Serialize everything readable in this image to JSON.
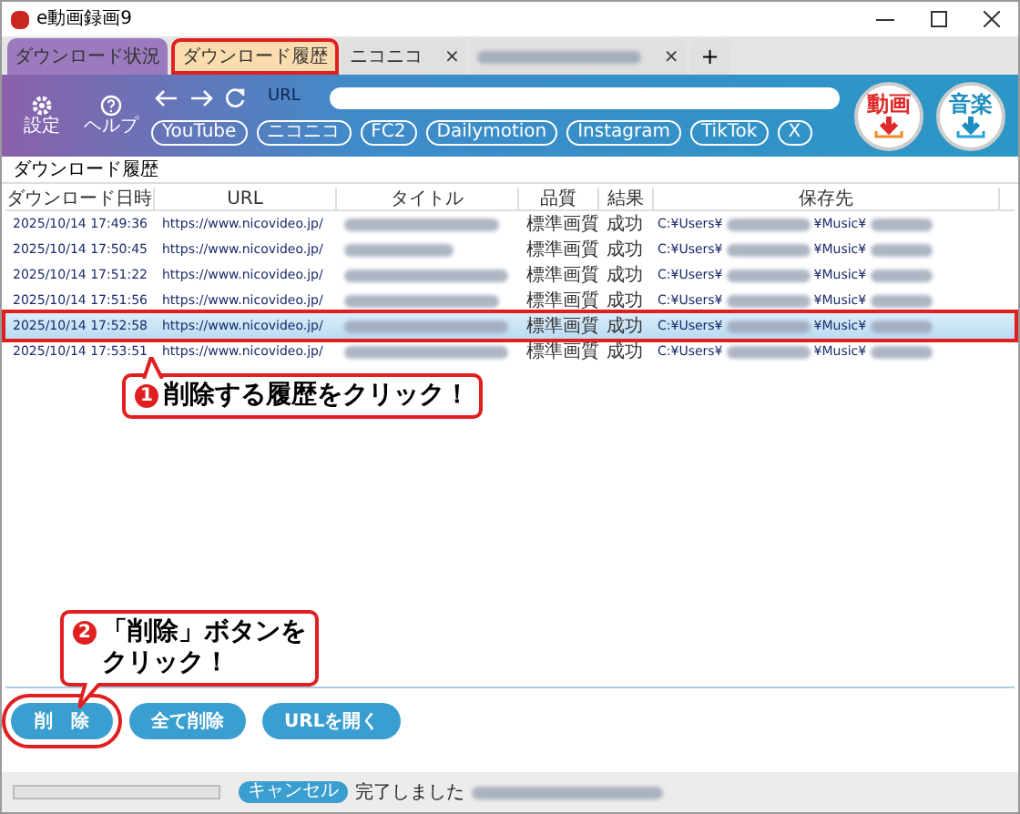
{
  "window": {
    "title": "e動画録画9"
  },
  "tabs": [
    {
      "label": "ダウンロード状況",
      "selected": false,
      "color": "#9b7bbd"
    },
    {
      "label": "ダウンロード履歴",
      "selected": true,
      "color": "#fbdcae"
    },
    {
      "label": "ニコニコ",
      "selected": false,
      "close": "×",
      "color": "#e0e0e0"
    },
    {
      "kind": "blurred",
      "selected": false,
      "close": "×",
      "color": "#e0e0e0"
    }
  ],
  "new_tab": "+",
  "toolbar": {
    "settings": "設定",
    "help": "ヘルプ",
    "url_label": "URL",
    "sites": [
      "YouTube",
      "ニコニコ",
      "FC2",
      "Dailymotion",
      "Instagram",
      "TikTok",
      "X"
    ],
    "video_button": "動画",
    "music_button": "音楽"
  },
  "section_title": "ダウンロード履歴",
  "table": {
    "columns": [
      "ダウンロード日時",
      "URL",
      "タイトル",
      "品質",
      "結果",
      "保存先"
    ],
    "rows": [
      {
        "date": "2025/10/14 17:49:36",
        "url": "https://www.nicovideo.jp/",
        "quality": "標準画質",
        "result": "成功",
        "path_start": "C:¥Users¥",
        "path_mid": "¥Music¥",
        "selected": false
      },
      {
        "date": "2025/10/14 17:50:45",
        "url": "https://www.nicovideo.jp/",
        "quality": "標準画質",
        "result": "成功",
        "path_start": "C:¥Users¥",
        "path_mid": "¥Music¥",
        "selected": false
      },
      {
        "date": "2025/10/14 17:51:22",
        "url": "https://www.nicovideo.jp/",
        "quality": "標準画質",
        "result": "成功",
        "path_start": "C:¥Users¥",
        "path_mid": "¥Music¥",
        "selected": false
      },
      {
        "date": "2025/10/14 17:51:56",
        "url": "https://www.nicovideo.jp/",
        "quality": "標準画質",
        "result": "成功",
        "path_start": "C:¥Users¥",
        "path_mid": "¥Music¥",
        "selected": false
      },
      {
        "date": "2025/10/14 17:52:58",
        "url": "https://www.nicovideo.jp/",
        "quality": "標準画質",
        "result": "成功",
        "path_start": "C:¥Users¥",
        "path_mid": "¥Music¥",
        "selected": true
      },
      {
        "date": "2025/10/14 17:53:51",
        "url": "https://www.nicovideo.jp/",
        "quality": "標準画質",
        "result": "成功",
        "path_start": "C:¥Users¥",
        "path_mid": "¥Music¥",
        "selected": false
      }
    ]
  },
  "buttons": [
    "削　除",
    "全て削除",
    "URLを開く"
  ],
  "status_bar": {
    "progress": {
      "level": 0
    },
    "cancel": "キャンセル",
    "message": "完了しました"
  },
  "annotations": [
    {
      "number": "1",
      "lines": [
        "削除する履歴をクリック！"
      ]
    },
    {
      "number": "2",
      "lines": [
        "「削除」ボタンを",
        "クリック！"
      ]
    }
  ]
}
